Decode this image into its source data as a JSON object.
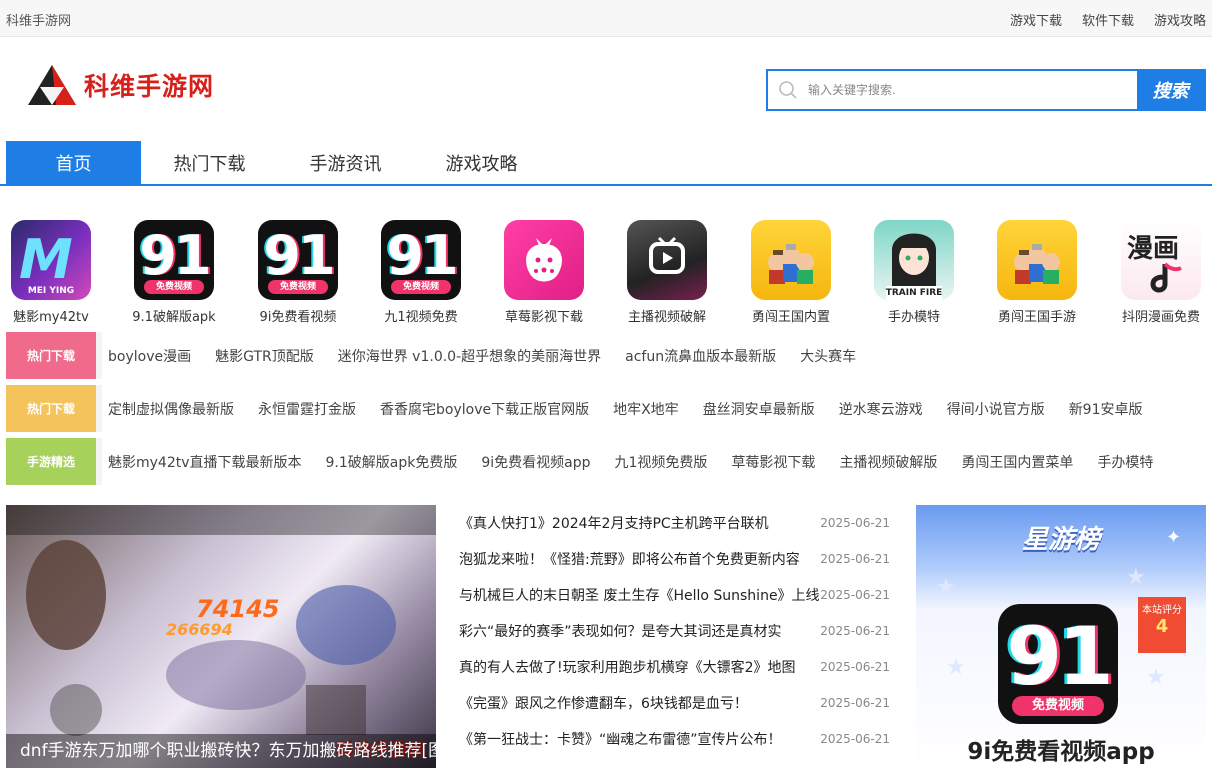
{
  "topbar": {
    "site_name": "科维手游网",
    "links": [
      "游戏下载",
      "软件下载",
      "游戏攻略"
    ]
  },
  "header": {
    "logo_text": "科维手游网",
    "search_placeholder": "输入关键字搜索.",
    "search_button": "搜索"
  },
  "nav": {
    "tabs": [
      {
        "label": "首页",
        "active": true
      },
      {
        "label": "热门下载",
        "active": false
      },
      {
        "label": "手游资讯",
        "active": false
      },
      {
        "label": "游戏攻略",
        "active": false
      }
    ]
  },
  "apps": [
    {
      "name": "魅影my42tv",
      "icon": "meiying-app-icon",
      "icon_text": "MEI YING"
    },
    {
      "name": "9.1破解版apk",
      "icon": "91-video-app-icon",
      "icon_text": "免费视频"
    },
    {
      "name": "9i免费看视频",
      "icon": "91-video-app-icon",
      "icon_text": "免费视频"
    },
    {
      "name": "九1视频免费",
      "icon": "91-video-app-icon",
      "icon_text": "免费视频"
    },
    {
      "name": "草莓影视下载",
      "icon": "strawberry-app-icon"
    },
    {
      "name": "主播视频破解",
      "icon": "tv-app-icon"
    },
    {
      "name": "勇闯王国内置",
      "icon": "brave-kingdom-app-icon"
    },
    {
      "name": "手办模特",
      "icon": "anime-figure-app-icon",
      "icon_text": "TRAIN FIRE"
    },
    {
      "name": "勇闯王国手游",
      "icon": "brave-kingdom-app-icon"
    },
    {
      "name": "抖阴漫画免费",
      "icon": "manga-app-icon",
      "icon_text": "漫画"
    }
  ],
  "keyword_rows": [
    {
      "tag": "热门下载",
      "color": "#f06b8b",
      "items": [
        "boylove漫画",
        "魅影GTR顶配版",
        "迷你海世界 v1.0.0-超乎想象的美丽海世界",
        "acfun流鼻血版本最新版",
        "大头赛车"
      ]
    },
    {
      "tag": "热门下载",
      "color": "#f5c35b",
      "items": [
        "定制虚拟偶像最新版",
        "永恒雷霆打金版",
        "香香腐宅boylove下载正版官网版",
        "地牢X地牢",
        "盘丝洞安卓最新版",
        "逆水寒云游戏",
        "得间小说官方版",
        "新91安卓版"
      ]
    },
    {
      "tag": "手游精选",
      "color": "#a6d15a",
      "items": [
        "魅影my42tv直播下载最新版本",
        "9.1破解版apk免费版",
        "9i免费看视频app",
        "九1视频免费版",
        "草莓影视下载",
        "主播视频破解版",
        "勇闯王国内置菜单",
        "手办模特"
      ]
    }
  ],
  "feature": {
    "caption": "dnf手游东万加哪个职业搬砖快？东万加搬砖路线推荐[图",
    "numbers": [
      "74145",
      "266694"
    ],
    "brand": "科维手游网"
  },
  "news": [
    {
      "title": "《真人快打1》2024年2月支持PC主机跨平台联机",
      "date": "2025-06-21"
    },
    {
      "title": "泡狐龙来啦！《怪猎:荒野》即将公布首个免费更新内容",
      "date": "2025-06-21"
    },
    {
      "title": "与机械巨人的末日朝圣 废土生存《Hello Sunshine》上线",
      "date": "2025-06-21"
    },
    {
      "title": "彩六“最好的赛季”表现如何？是夸大其词还是真材实",
      "date": "2025-06-21"
    },
    {
      "title": "真的有人去做了!玩家利用跑步机横穿《大镖客2》地图",
      "date": "2025-06-21"
    },
    {
      "title": "《完蛋》跟风之作惨遭翻车，6块钱都是血亏！",
      "date": "2025-06-21"
    },
    {
      "title": "《第一狂战士：卡赞》“幽魂之布雷德”宣传片公布！",
      "date": "2025-06-21"
    }
  ],
  "panel": {
    "title": "星游榜",
    "rating_label": "本站评分",
    "rating_value": "4",
    "app_name": "9i免费看视频app",
    "icon_digits": "91",
    "icon_label": "免费视频"
  },
  "colors": {
    "accent": "#1f7de6",
    "logo_red": "#d8201a"
  }
}
